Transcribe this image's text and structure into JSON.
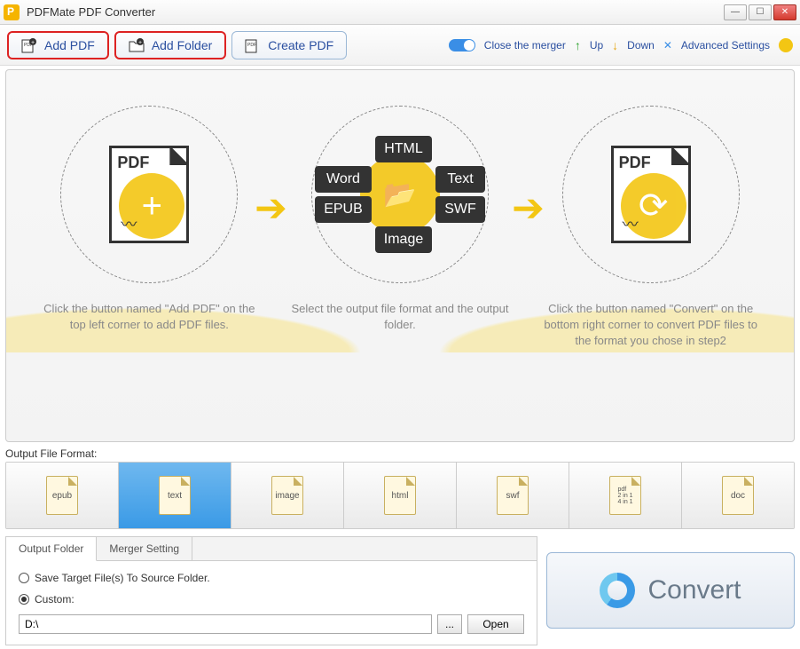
{
  "title": "PDFMate PDF Converter",
  "toolbar": {
    "add_pdf": "Add PDF",
    "add_folder": "Add Folder",
    "create_pdf": "Create PDF",
    "close_merger": "Close the merger",
    "up": "Up",
    "down": "Down",
    "advanced": "Advanced Settings"
  },
  "steps": {
    "s1": "Click the button named \"Add PDF\" on the top left corner to add PDF files.",
    "s2": "Select the output file format and the output folder.",
    "s3": "Click the button named \"Convert\" on the bottom right corner to convert PDF files to the format you chose in step2",
    "fmts": {
      "html": "HTML",
      "word": "Word",
      "text": "Text",
      "epub": "EPUB",
      "swf": "SWF",
      "image": "Image"
    },
    "pdf_label": "PDF"
  },
  "output_label": "Output File Format:",
  "formats": [
    "epub",
    "text",
    "image",
    "html",
    "swf",
    "pdf\n2 in 1\n4 in 1",
    "doc"
  ],
  "selected_format_index": 1,
  "tabs": {
    "output_folder": "Output Folder",
    "merger": "Merger Setting"
  },
  "out": {
    "save_source": "Save Target File(s) To Source Folder.",
    "custom": "Custom:",
    "path": "D:\\",
    "browse": "...",
    "open": "Open"
  },
  "convert": "Convert"
}
